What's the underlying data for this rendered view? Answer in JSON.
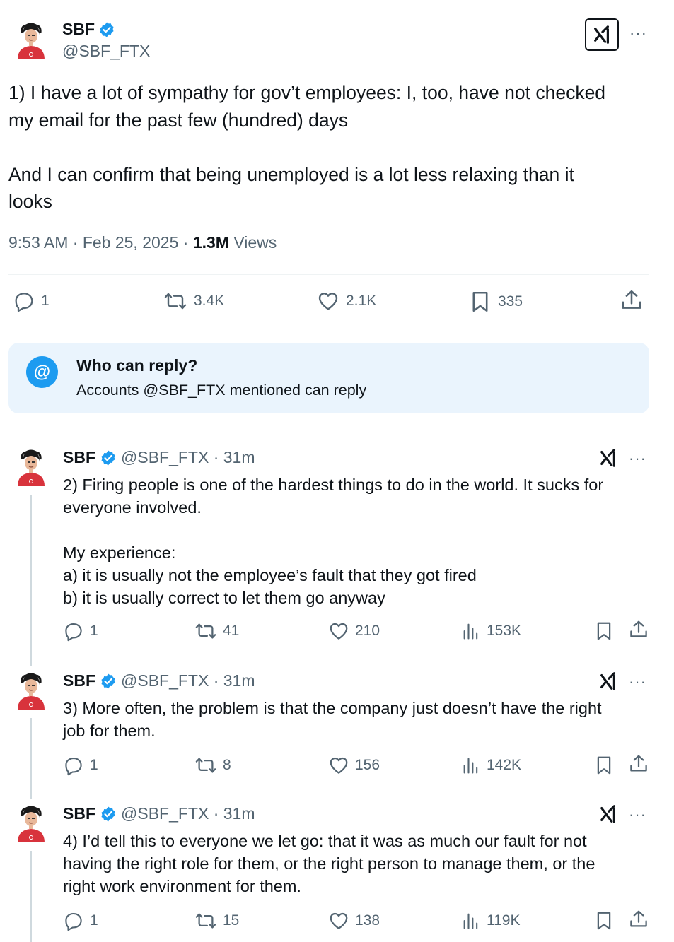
{
  "main_tweet": {
    "author_name": "SBF",
    "author_handle": "@SBF_FTX",
    "more_icon": "···",
    "text": "1) I have a lot of sympathy for gov’t employees: I, too, have not checked\nmy email for the past few (hundred) days\n\nAnd I can confirm that being unemployed is a lot less relaxing than it\nlooks",
    "timestamp": "9:53 AM · Feb 25, 2025 · ",
    "views_count": "1.3M",
    "views_label": " Views",
    "stats": {
      "replies": "1",
      "reposts": "3.4K",
      "likes": "2.1K",
      "bookmarks": "335"
    }
  },
  "who_can_reply": {
    "icon": "@",
    "title": "Who can reply?",
    "subtitle": "Accounts @SBF_FTX mentioned can reply"
  },
  "replies": [
    {
      "author_name": "SBF",
      "handle_time": "@SBF_FTX · 31m",
      "more_icon": "···",
      "text": "2) Firing people is one of the hardest things to do in the world. It sucks for\neveryone involved.\n\nMy experience:\na) it is usually not the employee’s fault that they got fired\nb) it is usually correct to let them go anyway",
      "replies": "1",
      "reposts": "41",
      "likes": "210",
      "views": "153K"
    },
    {
      "author_name": "SBF",
      "handle_time": "@SBF_FTX · 31m",
      "more_icon": "···",
      "text": "3) More often, the problem is that the company just doesn’t have the right\njob for them.",
      "replies": "1",
      "reposts": "8",
      "likes": "156",
      "views": "142K"
    },
    {
      "author_name": "SBF",
      "handle_time": "@SBF_FTX · 31m",
      "more_icon": "···",
      "text": "4) I’d tell this to everyone we let go: that it was as much our fault for not\nhaving the right role for them, or the right person to manage them, or the\nright work environment for them.",
      "replies": "1",
      "reposts": "15",
      "likes": "138",
      "views": "119K"
    }
  ],
  "colors": {
    "verified": "#1d9bf0",
    "muted_text": "#536471",
    "reply_box_bg": "#eaf4fd",
    "thread_line": "#cfd9de"
  },
  "icons": [
    "avatar",
    "verified-badge-icon",
    "grok-icon",
    "more-icon",
    "reply-icon",
    "repost-icon",
    "like-icon",
    "bookmark-icon",
    "share-icon",
    "views-icon",
    "at-mention-icon"
  ]
}
